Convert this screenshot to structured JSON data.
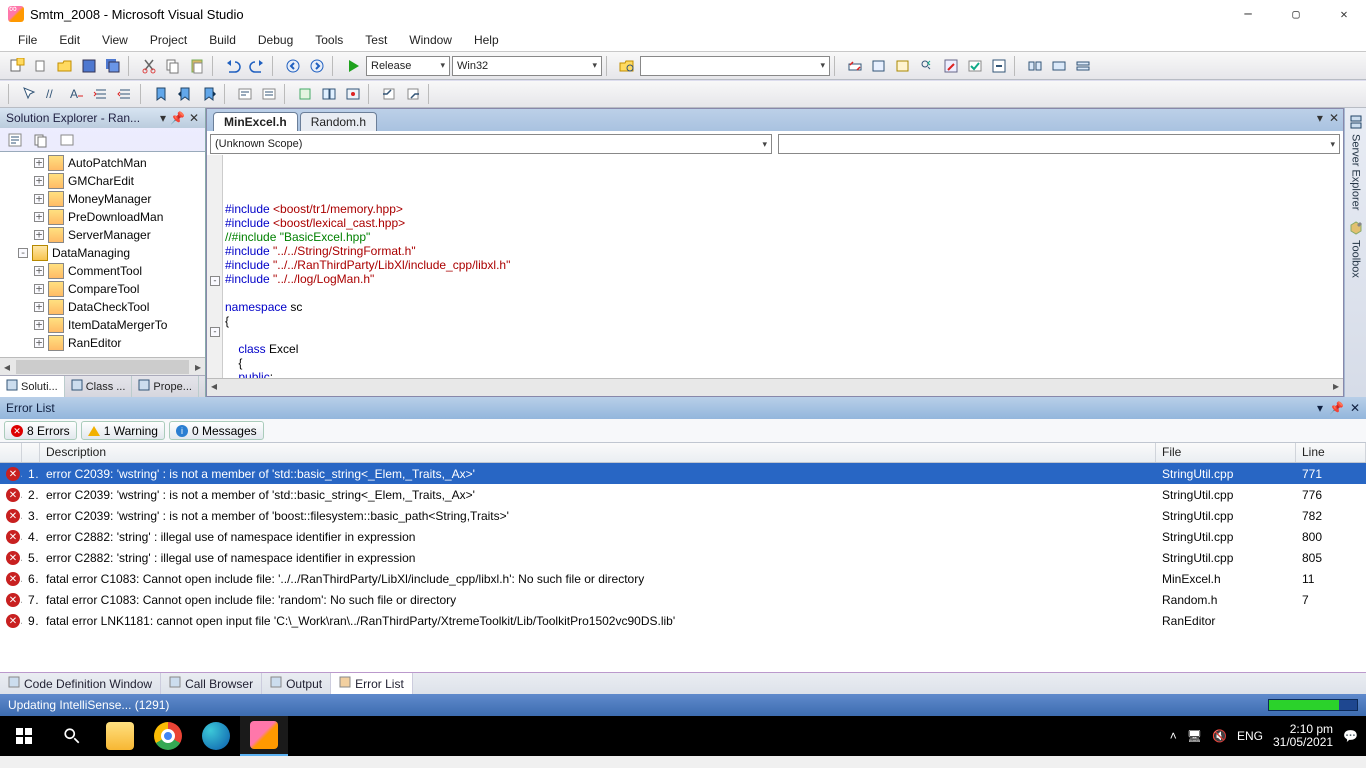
{
  "title": "Smtm_2008 - Microsoft Visual Studio",
  "menu": [
    "File",
    "Edit",
    "View",
    "Project",
    "Build",
    "Debug",
    "Tools",
    "Test",
    "Window",
    "Help"
  ],
  "config_combo": "Release",
  "platform_combo": "Win32",
  "solution_explorer": {
    "header": "Solution Explorer - Ran...",
    "items": [
      {
        "depth": 2,
        "exp": "+",
        "icon": "proj",
        "label": "AutoPatchMan"
      },
      {
        "depth": 2,
        "exp": "+",
        "icon": "proj",
        "label": "GMCharEdit"
      },
      {
        "depth": 2,
        "exp": "+",
        "icon": "proj",
        "label": "MoneyManager"
      },
      {
        "depth": 2,
        "exp": "+",
        "icon": "proj",
        "label": "PreDownloadMan"
      },
      {
        "depth": 2,
        "exp": "+",
        "icon": "proj",
        "label": "ServerManager"
      },
      {
        "depth": 1,
        "exp": "-",
        "icon": "fold",
        "label": "DataManaging"
      },
      {
        "depth": 2,
        "exp": "+",
        "icon": "proj",
        "label": "CommentTool"
      },
      {
        "depth": 2,
        "exp": "+",
        "icon": "proj",
        "label": "CompareTool"
      },
      {
        "depth": 2,
        "exp": "+",
        "icon": "proj",
        "label": "DataCheckTool"
      },
      {
        "depth": 2,
        "exp": "+",
        "icon": "proj",
        "label": "ItemDataMergerTo"
      },
      {
        "depth": 2,
        "exp": "+",
        "icon": "proj",
        "label": "RanEditor"
      }
    ],
    "tabs": [
      "Soluti...",
      "Class ...",
      "Prope..."
    ]
  },
  "editor": {
    "tabs": [
      {
        "label": "MinExcel.h",
        "active": true
      },
      {
        "label": "Random.h",
        "active": false
      }
    ],
    "scope": "(Unknown Scope)",
    "code_lines": [
      {
        "t": "inc",
        "h": "#include",
        "a": "<boost/tr1/memory.hpp>"
      },
      {
        "t": "inc",
        "h": "#include",
        "a": "<boost/lexical_cast.hpp>"
      },
      {
        "t": "cmt",
        "h": "//#include \"BasicExcel.hpp\""
      },
      {
        "t": "inc",
        "h": "#include",
        "a": "\"../../String/StringFormat.h\""
      },
      {
        "t": "inc",
        "h": "#include",
        "a": "\"../../RanThirdParty/LibXl/include_cpp/libxl.h\""
      },
      {
        "t": "inc",
        "h": "#include",
        "a": "\"../../log/LogMan.h\""
      },
      {
        "t": "blank"
      },
      {
        "t": "ns",
        "h": "namespace",
        "a": "sc",
        "fold": "-"
      },
      {
        "t": "txt",
        "a": "{"
      },
      {
        "t": "blank"
      },
      {
        "t": "cls",
        "h": "class",
        "a": "Excel",
        "indent": "    ",
        "fold": "-"
      },
      {
        "t": "txt",
        "a": "    {"
      },
      {
        "t": "kw",
        "h": "public",
        "a": ":",
        "indent": "    "
      }
    ]
  },
  "right_rail": [
    "Server Explorer",
    "Toolbox"
  ],
  "error_list": {
    "header": "Error List",
    "filters": {
      "errors": "8 Errors",
      "warnings": "1 Warning",
      "messages": "0 Messages"
    },
    "cols": [
      "",
      "",
      "Description",
      "File",
      "Line"
    ],
    "rows": [
      {
        "n": "1",
        "desc": "error C2039: 'wstring' : is not a member of 'std::basic_string<_Elem,_Traits,_Ax>'",
        "file": "StringUtil.cpp",
        "line": "771",
        "sel": true
      },
      {
        "n": "2",
        "desc": "error C2039: 'wstring' : is not a member of 'std::basic_string<_Elem,_Traits,_Ax>'",
        "file": "StringUtil.cpp",
        "line": "776"
      },
      {
        "n": "3",
        "desc": "error C2039: 'wstring' : is not a member of 'boost::filesystem::basic_path<String,Traits>'",
        "file": "StringUtil.cpp",
        "line": "782"
      },
      {
        "n": "4",
        "desc": "error C2882: 'string' : illegal use of namespace identifier in expression",
        "file": "StringUtil.cpp",
        "line": "800"
      },
      {
        "n": "5",
        "desc": "error C2882: 'string' : illegal use of namespace identifier in expression",
        "file": "StringUtil.cpp",
        "line": "805"
      },
      {
        "n": "6",
        "desc": "fatal error C1083: Cannot open include file: '../../RanThirdParty/LibXl/include_cpp/libxl.h': No such file or directory",
        "file": "MinExcel.h",
        "line": "11"
      },
      {
        "n": "7",
        "desc": "fatal error C1083: Cannot open include file: 'random': No such file or directory",
        "file": "Random.h",
        "line": "7"
      },
      {
        "n": "9",
        "desc": "fatal error LNK1181: cannot open input file 'C:\\_Work\\ran\\../RanThirdParty/XtremeToolkit/Lib/ToolkitPro1502vc90DS.lib'",
        "file": "RanEditor",
        "line": ""
      }
    ]
  },
  "bottom_tabs": [
    "Code Definition Window",
    "Call Browser",
    "Output",
    "Error List"
  ],
  "status": "Updating IntelliSense... (1291)",
  "tray": {
    "lang": "ENG",
    "time": "2:10 pm",
    "date": "31/05/2021"
  }
}
